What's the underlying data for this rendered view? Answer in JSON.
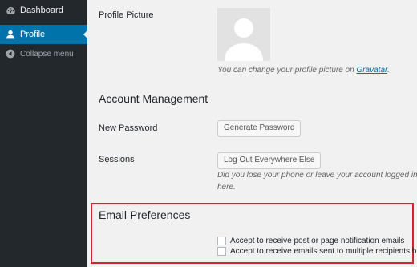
{
  "sidebar": {
    "items": [
      {
        "label": "Dashboard",
        "icon": "dashboard-icon"
      },
      {
        "label": "Profile",
        "icon": "user-icon"
      },
      {
        "label": "Collapse menu",
        "icon": "collapse-arrow-icon"
      }
    ],
    "active": "Profile"
  },
  "profile_picture": {
    "label": "Profile Picture",
    "description_prefix": "You can change your profile picture on ",
    "gravatar_link": "Gravatar",
    "description_suffix": "."
  },
  "account_management": {
    "heading": "Account Management",
    "new_password": {
      "label": "New Password",
      "button": "Generate Password"
    },
    "sessions": {
      "label": "Sessions",
      "button": "Log Out Everywhere Else",
      "description_line1": "Did you lose your phone or leave your account logged in at a",
      "description_line2": "here."
    }
  },
  "email_preferences": {
    "heading": "Email Preferences",
    "options": [
      {
        "label": "Accept to receive post or page notification emails",
        "checked": false
      },
      {
        "label": "Accept to receive emails sent to multiple recipients b",
        "checked": false
      }
    ]
  },
  "colors": {
    "sidebar_bg": "#23282d",
    "active_item": "#0073aa",
    "highlight_border": "#d0262e",
    "page_bg": "#f1f1f1"
  }
}
